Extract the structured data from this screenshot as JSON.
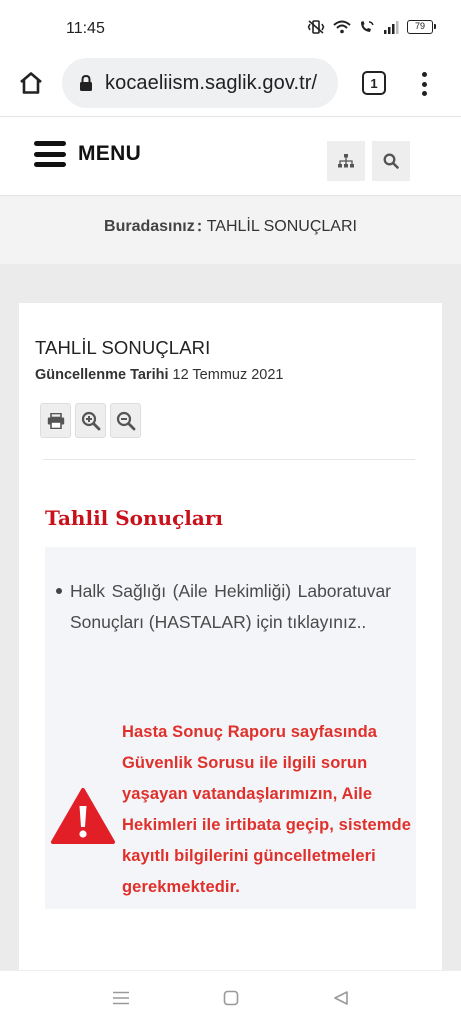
{
  "status_bar": {
    "time": "11:45",
    "battery": "79",
    "icons": [
      "vibrate-icon",
      "wifi-icon",
      "wifi-calling-icon",
      "signal-icon",
      "battery-icon"
    ]
  },
  "browser": {
    "url": "kocaeliism.saglik.gov.tr/",
    "tab_count": "1",
    "icons": [
      "home-icon",
      "lock-icon",
      "more-vert-icon"
    ]
  },
  "header": {
    "menu_label": "MENU",
    "icons": [
      "hamburger-icon",
      "sitemap-icon",
      "search-icon"
    ]
  },
  "breadcrumb": {
    "label": "Buradasınız",
    "current": "TAHLİL SONUÇLARI"
  },
  "page": {
    "title": "TAHLİL SONUÇLARI",
    "updated_label": "Güncellenme Tarihi",
    "updated_date": "12 Temmuz 2021",
    "tool_icons": [
      "print-icon",
      "zoom-in-icon",
      "zoom-out-icon"
    ],
    "section_title": "Tahlil Sonuçları",
    "link_text": "Halk Sağlığı (Aile Hekimliği) Laboratuvar Sonuçları (HASTALAR) için tıklayınız..",
    "warning_text": "Hasta Sonuç Raporu sayfasında Güvenlik Sorusu ile ilgili sorun yaşayan vatandaşlarımızın, Aile Hekimleri ile irtibata geçip, sistemde kayıtlı bilgilerini güncelletmeleri gerekmektedir.",
    "colors": {
      "section_title": "#c8111b",
      "warning": "#e0302b"
    }
  },
  "system_nav": {
    "icons": [
      "recents-icon",
      "home-square-icon",
      "back-triangle-icon"
    ]
  }
}
